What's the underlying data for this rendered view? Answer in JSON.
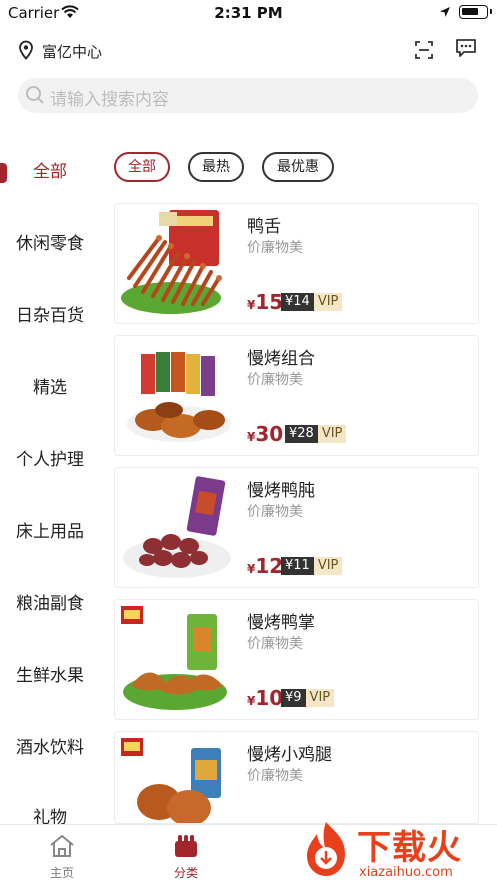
{
  "status_bar": {
    "carrier": "Carrier",
    "time": "2:31 PM"
  },
  "header": {
    "location": "富亿中心"
  },
  "search": {
    "placeholder": "请输入搜索内容"
  },
  "sidebar": {
    "items": [
      {
        "label": "全部",
        "active": true
      },
      {
        "label": "休闲零食"
      },
      {
        "label": "日杂百货"
      },
      {
        "label": "精选"
      },
      {
        "label": "个人护理"
      },
      {
        "label": "床上用品"
      },
      {
        "label": "粮油副食"
      },
      {
        "label": "生鲜水果"
      },
      {
        "label": "酒水饮料"
      },
      {
        "label": "礼物"
      }
    ]
  },
  "filters": [
    {
      "label": "全部",
      "active": true
    },
    {
      "label": "最热"
    },
    {
      "label": "最优惠"
    }
  ],
  "products": [
    {
      "name": "鸭舌",
      "subtitle": "价廉物美",
      "currency": "¥",
      "price": "15",
      "vip_price": "¥14",
      "vip_tag": "VIP"
    },
    {
      "name": "慢烤组合",
      "subtitle": "价廉物美",
      "currency": "¥",
      "price": "30",
      "vip_price": "¥28",
      "vip_tag": "VIP"
    },
    {
      "name": "慢烤鸭肫",
      "subtitle": "价廉物美",
      "currency": "¥",
      "price": "12",
      "vip_price": "¥11",
      "vip_tag": "VIP"
    },
    {
      "name": "慢烤鸭掌",
      "subtitle": "价廉物美",
      "currency": "¥",
      "price": "10",
      "vip_price": "¥9",
      "vip_tag": "VIP"
    },
    {
      "name": "慢烤小鸡腿",
      "subtitle": "价廉物美",
      "currency": "¥",
      "price": "",
      "vip_price": "",
      "vip_tag": ""
    }
  ],
  "tabbar": {
    "items": [
      {
        "label": "主页",
        "icon": "home-icon"
      },
      {
        "label": "分类",
        "icon": "category-icon",
        "active": true
      }
    ]
  },
  "watermark": {
    "text": "下载火",
    "url": "xiazaihuo.com"
  },
  "colors": {
    "accent": "#a3262d",
    "watermark": "#e8401c",
    "vip_dark": "#333333",
    "vip_light": "#f4e6c6"
  }
}
